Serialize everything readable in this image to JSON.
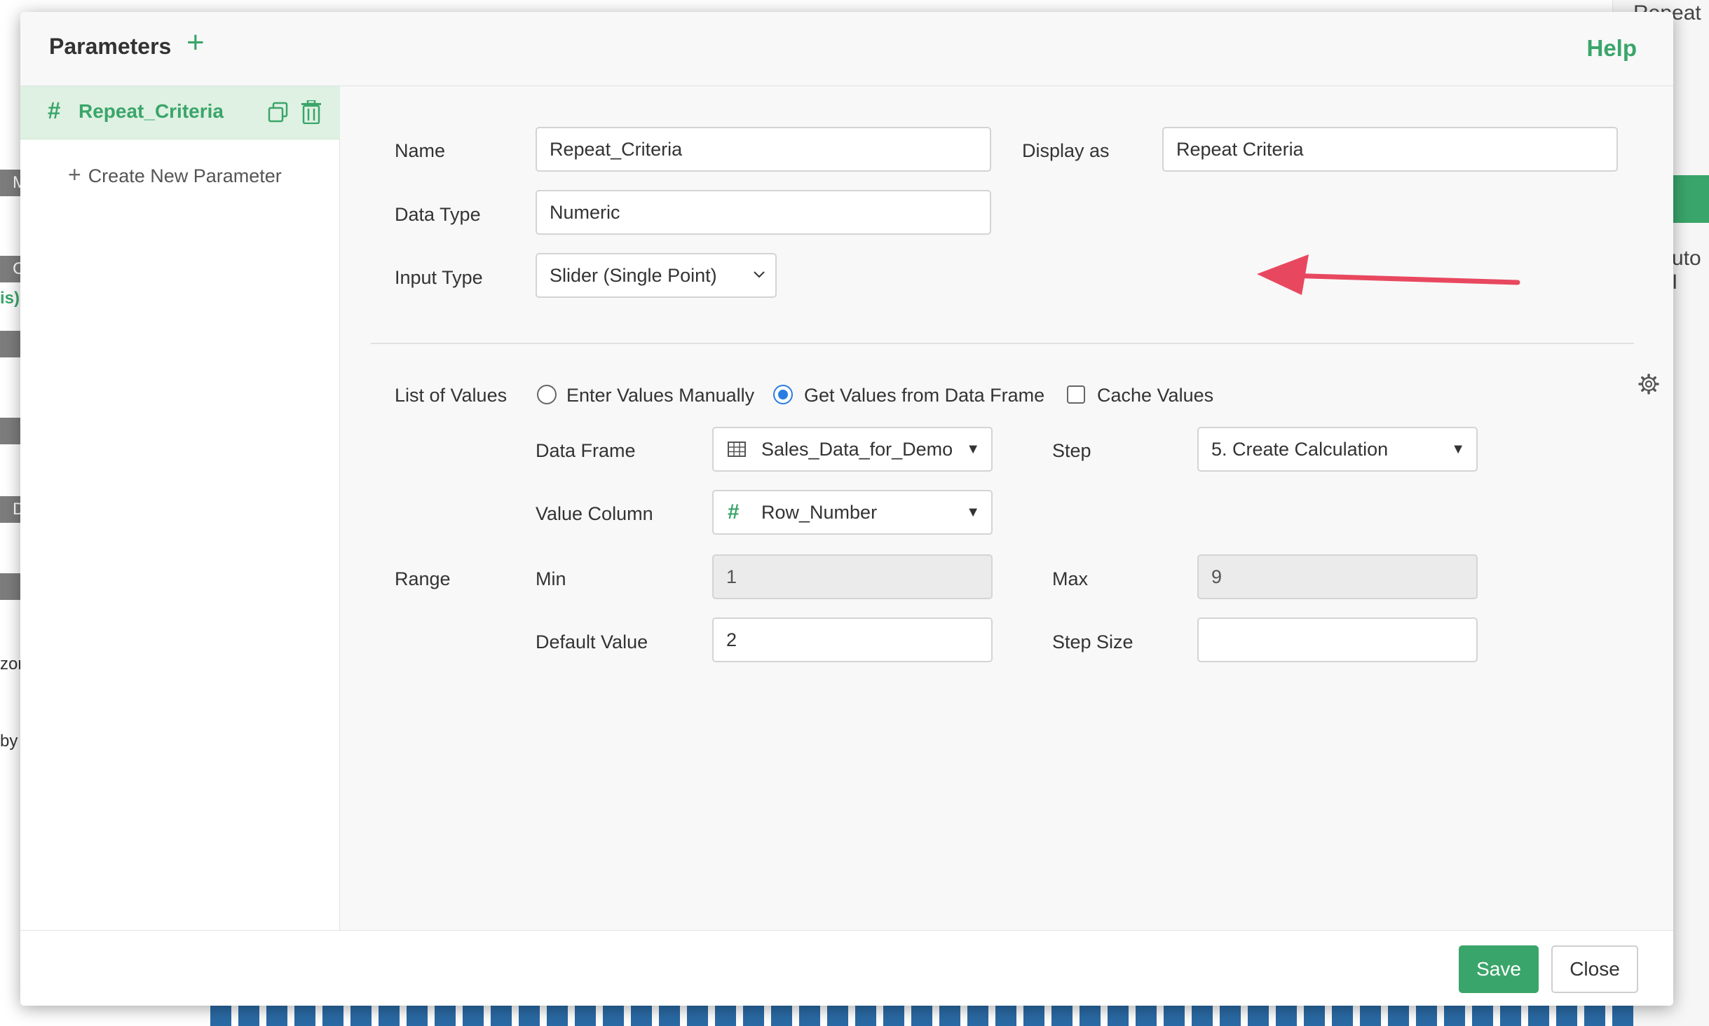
{
  "background": {
    "top_right_text": "Repeat C",
    "auto_text": "uto I",
    "left_fragments": [
      "M",
      "C",
      "is)",
      "D",
      "zor",
      "by"
    ]
  },
  "modal": {
    "title": "Parameters",
    "help_label": "Help"
  },
  "sidebar": {
    "parameter": {
      "type_icon": "#",
      "name": "Repeat_Criteria"
    },
    "create_new_label": "Create New Parameter"
  },
  "form": {
    "name_label": "Name",
    "name_value": "Repeat_Criteria",
    "display_as_label": "Display as",
    "display_as_value": "Repeat Criteria",
    "data_type_label": "Data Type",
    "data_type_value": "Numeric",
    "input_type_label": "Input Type",
    "input_type_value": "Slider (Single Point)",
    "list_of_values_label": "List of Values",
    "options": {
      "manual_label": "Enter Values Manually",
      "manual_checked": false,
      "dataframe_label": "Get Values from Data Frame",
      "dataframe_checked": true,
      "cache_label": "Cache Values",
      "cache_checked": false
    },
    "data_frame_label": "Data Frame",
    "data_frame_value": "Sales_Data_for_Demo",
    "step_label": "Step",
    "step_value": "5. Create Calculation",
    "value_column_label": "Value Column",
    "value_column_icon": "#",
    "value_column_value": "Row_Number",
    "range_label": "Range",
    "min_label": "Min",
    "min_value": "1",
    "max_label": "Max",
    "max_value": "9",
    "default_value_label": "Default Value",
    "default_value": "2",
    "step_size_label": "Step Size",
    "step_size_value": ""
  },
  "footer": {
    "save_label": "Save",
    "close_label": "Close"
  },
  "colors": {
    "accent_green": "#3aa56a",
    "selected_row": "#dff1e2",
    "radio_blue": "#2a7de1",
    "arrow_red": "#e8485f"
  }
}
